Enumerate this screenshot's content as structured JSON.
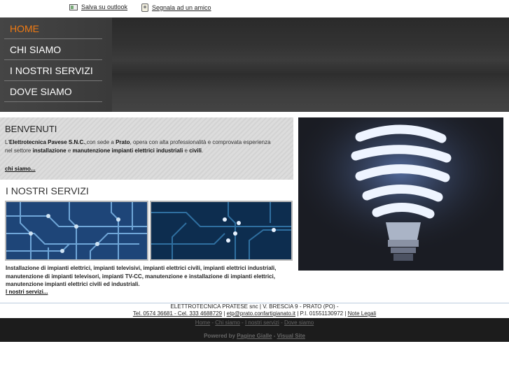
{
  "topbar": {
    "outlook_label": "Salva su outlook",
    "friend_label": "Segnala ad un amico",
    "outlook_icon": "outlook-icon",
    "friend_icon": "friend-icon"
  },
  "nav": {
    "items": [
      {
        "label": "HOME",
        "active": true
      },
      {
        "label": "CHI SIAMO",
        "active": false
      },
      {
        "label": "I NOSTRI SERVIZI",
        "active": false
      },
      {
        "label": "DOVE SIAMO",
        "active": false
      }
    ],
    "active_color": "#f07a12"
  },
  "welcome": {
    "title": "BENVENUTI",
    "text_1": "L'",
    "company": "Elettrotecnica Pavese S.N.C.",
    "text_2": ",con sede a ",
    "city": "Prato",
    "text_3": ", opera con alta professionalità e comprovata esperienza nel settore ",
    "keyword_1": "installazione",
    "text_4": " e ",
    "keyword_2": "manutenzione impianti elettrici industriali",
    "text_5": " e ",
    "keyword_3": "civili",
    "text_6": ".",
    "link": "chi siamo..."
  },
  "services": {
    "title": "I NOSTRI SERVIZI",
    "text": "Installazione di impianti elettrici, impianti televisivi, impianti elettrici civili, impianti elettrici industriali, manutenzione di impianti televisori, impianti TV-CC, manutenzione e installazione di impianti elettrici, manutenzione impianti elettrici civili ed industriali.",
    "link": "I nostri servizi..."
  },
  "footer": {
    "line1": "ELETTROTECNICA PRATESE snc | V. BRESCIA 9 - PRATO (PO) -",
    "phone": "Tel. 0574 36681 - Cel. 333 4688729",
    "sep1": " | ",
    "email": "etp@prato.confartigianato.it",
    "vat": " | P.I. 01551130972 | ",
    "legal": "Note Legali",
    "nav": [
      "Home",
      "Chi siamo",
      "I nostri servizi",
      "Dove siamo"
    ],
    "nav_sep": " - ",
    "powered_label": "Powered by ",
    "powered_1": "Pagine Gialle",
    "powered_sep": " - ",
    "powered_2": "Visual Site"
  }
}
